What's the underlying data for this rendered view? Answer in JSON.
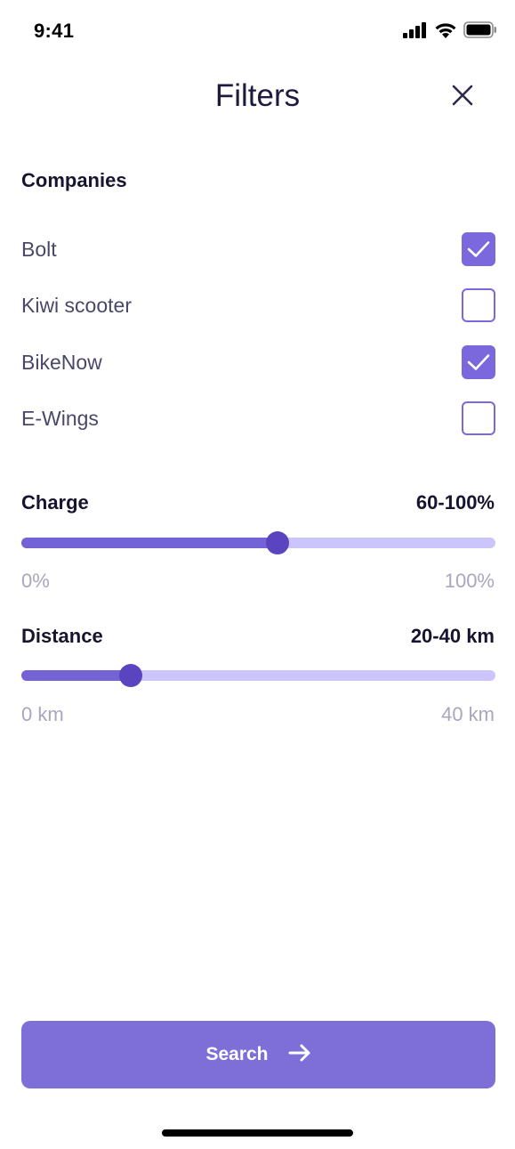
{
  "status_bar": {
    "time": "9:41"
  },
  "header": {
    "title": "Filters"
  },
  "companies": {
    "title": "Companies",
    "items": [
      {
        "label": "Bolt",
        "checked": true
      },
      {
        "label": "Kiwi scooter",
        "checked": false
      },
      {
        "label": "BikeNow",
        "checked": true
      },
      {
        "label": "E-Wings",
        "checked": false
      }
    ]
  },
  "charge": {
    "title": "Charge",
    "value_text": "60-100%",
    "min_label": "0%",
    "max_label": "100%",
    "thumb_fraction": 0.54
  },
  "distance": {
    "title": "Distance",
    "value_text": "20-40 km",
    "min_label": "0 km",
    "max_label": "40 km",
    "thumb_fraction": 0.23
  },
  "search_button": {
    "label": "Search"
  },
  "colors": {
    "accent": "#7b68dd",
    "slider_fill": "#7463d6",
    "slider_track": "#ccc5fb",
    "slider_thumb": "#5b44c0",
    "button": "#7e6fd8"
  },
  "icons": {
    "close": "close-icon",
    "check": "checkmark-icon",
    "arrow": "arrow-right-icon",
    "signal": "cellular-signal-icon",
    "wifi": "wifi-icon",
    "battery": "battery-icon"
  }
}
